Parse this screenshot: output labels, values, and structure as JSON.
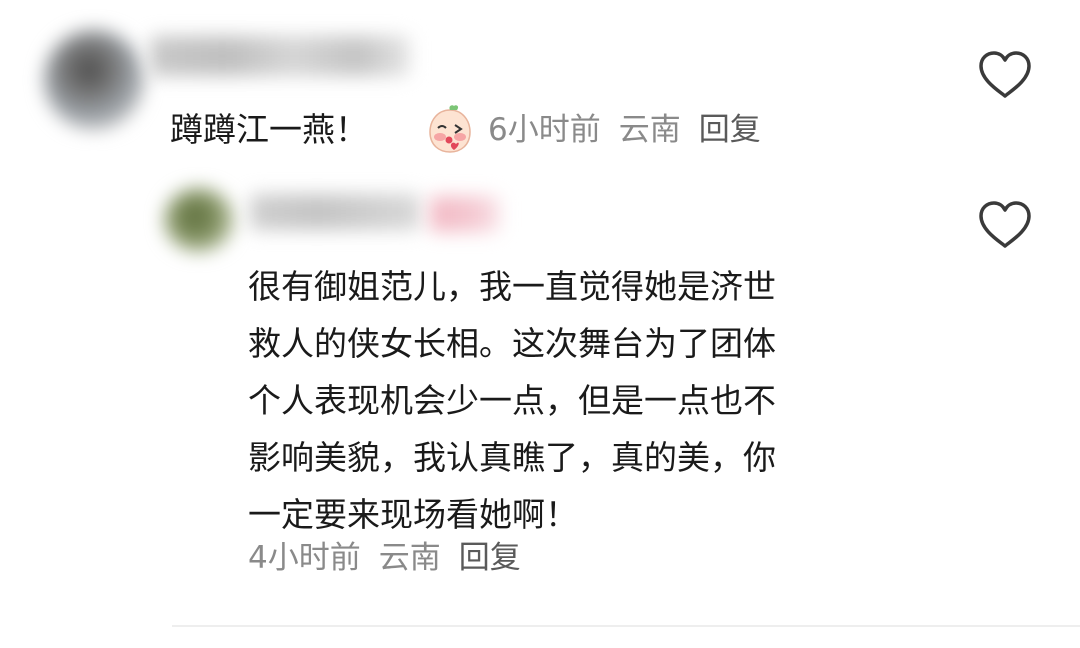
{
  "comment": {
    "text": "蹲蹲江一燕！",
    "emoji": "blushing-peach-emoji",
    "time": "6小时前",
    "location": "云南",
    "reply_label": "回复"
  },
  "reply": {
    "lines": [
      "很有御姐范儿，我一直觉得她是济世",
      "救人的侠女长相。这次舞台为了团体",
      "个人表现机会少一点，但是一点也不",
      "影响美貌，我认真瞧了，真的美，你",
      "一定要来现场看她啊！"
    ],
    "time": "4小时前",
    "location": "云南",
    "reply_label": "回复"
  },
  "icons": {
    "like": "heart-outline-icon"
  },
  "colors": {
    "text": "#1a1a1a",
    "meta": "#8a8a8a",
    "icon": "#3a3a3a"
  }
}
